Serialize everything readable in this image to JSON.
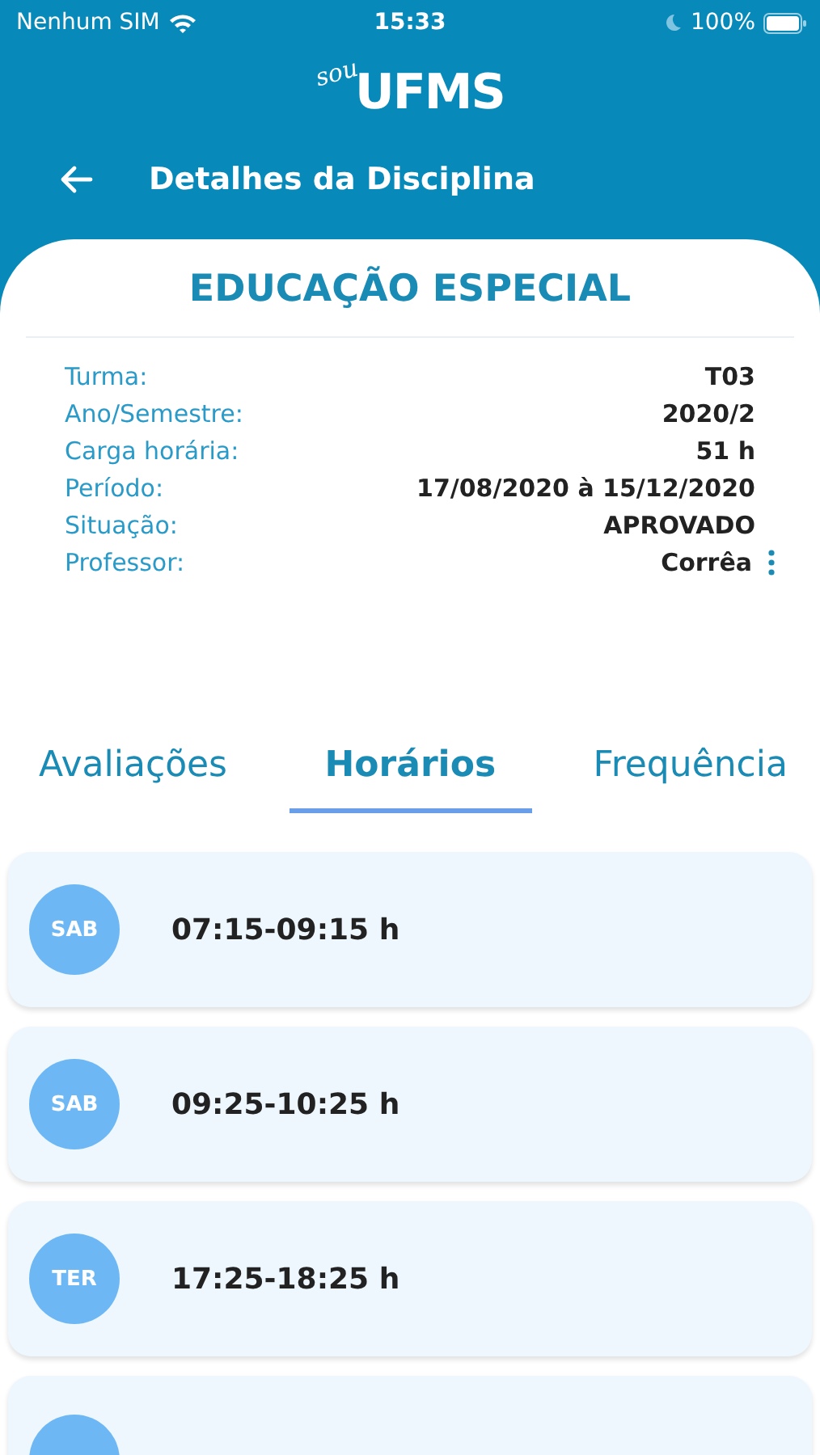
{
  "status_bar": {
    "carrier": "Nenhum SIM",
    "time": "15:33",
    "battery": "100%"
  },
  "logo": {
    "script": "sou",
    "wordmark": "UFMS"
  },
  "header": {
    "title": "Detalhes da Disciplina"
  },
  "course": {
    "title": "EDUCAÇÃO ESPECIAL",
    "details": [
      {
        "label": "Turma:",
        "value": "T03",
        "has_menu": false
      },
      {
        "label": "Ano/Semestre:",
        "value": "2020/2",
        "has_menu": false
      },
      {
        "label": "Carga horária:",
        "value": "51 h",
        "has_menu": false
      },
      {
        "label": "Período:",
        "value": "17/08/2020 à 15/12/2020",
        "has_menu": false
      },
      {
        "label": "Situação:",
        "value": "APROVADO",
        "has_menu": false
      },
      {
        "label": "Professor:",
        "value": "Corrêa",
        "has_menu": true
      }
    ]
  },
  "tabs": [
    {
      "label": "Avaliações",
      "selected": false
    },
    {
      "label": "Horários",
      "selected": true
    },
    {
      "label": "Frequência",
      "selected": false
    }
  ],
  "schedules": [
    {
      "kind": "full",
      "day": "SAB",
      "time": "07:15-09:15 h"
    },
    {
      "kind": "full",
      "day": "SAB",
      "time": "09:25-10:25 h"
    },
    {
      "kind": "full",
      "day": "TER",
      "time": "17:25-18:25 h"
    },
    {
      "kind": "partial"
    }
  ]
}
